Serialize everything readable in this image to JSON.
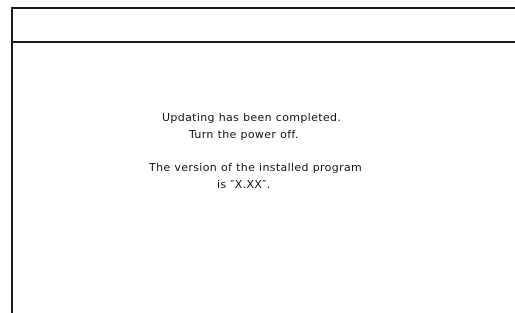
{
  "header": {
    "title": ""
  },
  "message": {
    "line1": "Updating has been completed.",
    "line2": "Turn the power off.",
    "line3": "The version of the installed program",
    "line4": "is ″X.XX″."
  },
  "colors": {
    "background": "#ffffff",
    "border": "#1a1a1a",
    "text": "#111111"
  }
}
